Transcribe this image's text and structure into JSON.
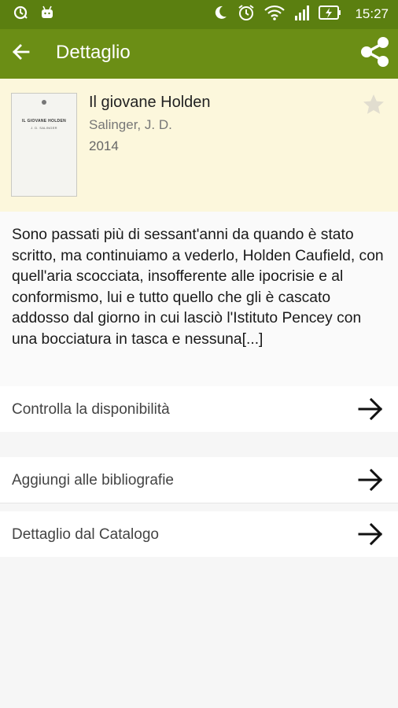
{
  "status_bar": {
    "time": "15:27",
    "left_icons": [
      "sync-icon",
      "android-icon"
    ],
    "right_icons": [
      "moon-icon",
      "alarm-icon",
      "wifi-icon",
      "signal-icon",
      "battery-charging-icon"
    ]
  },
  "app_bar": {
    "title": "Dettaglio",
    "back_icon": "arrow-back-icon",
    "share_icon": "share-icon",
    "color": "#6b8e15"
  },
  "book": {
    "title": "Il giovane Holden",
    "author": "Salinger, J. D.",
    "year": "2014",
    "cover_title": "IL GIOVANE HOLDEN",
    "cover_author": "J. D. SALINGER",
    "favorite_icon": "star-icon"
  },
  "description": "Sono passati più di sessant'anni da quando è stato scritto, ma continuiamo a vederlo, Holden Caufield, con quell'aria scocciata, insofferente alle ipocrisie e al conformismo, lui e tutto quello che gli è cascato addosso dal giorno in cui lasciò l'Istituto Pencey con una bocciatura in tasca e nessuna[...]",
  "actions": [
    {
      "label": "Controlla la disponibilità",
      "icon": "arrow-forward-icon"
    },
    {
      "label": "Aggiungi alle bibliografie",
      "icon": "arrow-forward-icon"
    },
    {
      "label": "Dettaglio dal Catalogo",
      "icon": "arrow-forward-icon"
    }
  ]
}
